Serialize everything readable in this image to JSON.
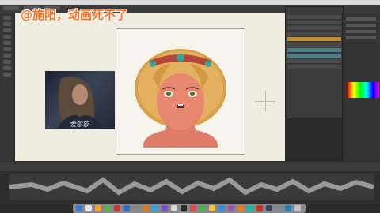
{
  "overlay": {
    "headline": "@施阳，动画死不了"
  },
  "reference": {
    "caption": "爱尔莎"
  },
  "panels": {
    "layers": {
      "rows": 10
    },
    "properties": {}
  },
  "colors": {
    "accent_orange": "#ff6b1a",
    "selected_layer": "#4d7f8a",
    "highlight_layer": "#c58a2a",
    "canvas_bg": "#efeddf"
  },
  "icons": [
    "menu-bar",
    "tool-icons",
    "dock-icons"
  ]
}
